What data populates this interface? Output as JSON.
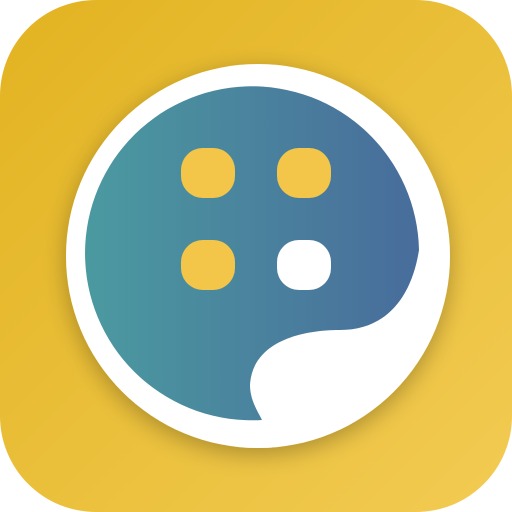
{
  "icon": {
    "name": "app-icon",
    "colors": {
      "background_start": "#E2B321",
      "background_end": "#F2CB52",
      "disc_start": "#4B9AA0",
      "disc_end": "#486C9B",
      "dot": "#F3C64A",
      "dot_highlight": "#FFFFFF",
      "ring": "#FFFFFF"
    }
  }
}
